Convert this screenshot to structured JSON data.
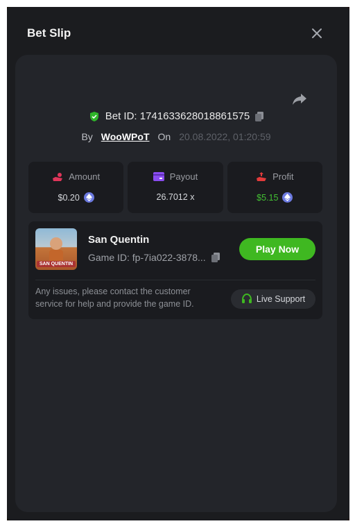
{
  "modal": {
    "title": "Bet Slip"
  },
  "bet": {
    "id_text": "Bet ID: 1741633628018861575",
    "by_label": "By",
    "username": "WooWPoT",
    "on_label": "On",
    "date": "20.08.2022, 01:20:59"
  },
  "stats": {
    "amount_label": "Amount",
    "amount_value": "$0.20",
    "payout_label": "Payout",
    "payout_value": "26.7012 x",
    "profit_label": "Profit",
    "profit_value": "$5.15"
  },
  "game": {
    "title": "San Quentin",
    "id_text": "Game ID: fp-7ia022-3878...",
    "thumb_label": "SAN QUENTIN",
    "play_button": "Play Now"
  },
  "support": {
    "notice": "Any issues, please contact the customer service for help and provide the game ID.",
    "button": "Live Support"
  },
  "colors": {
    "accent_green": "#3fb821",
    "profit_green": "#43c033",
    "eth_blue": "#6c7ae0",
    "amount_icon": "#e0365a",
    "payout_icon": "#8a4cf0",
    "profit_icon": "#e33b3b"
  },
  "icons": {
    "close": "close-icon",
    "share": "share-icon",
    "shield": "shield-check-icon",
    "copy": "copy-icon",
    "amount": "hand-coins-icon",
    "payout": "card-icon",
    "profit": "profit-hand-icon",
    "eth": "ethereum-icon",
    "headset": "headset-icon"
  }
}
